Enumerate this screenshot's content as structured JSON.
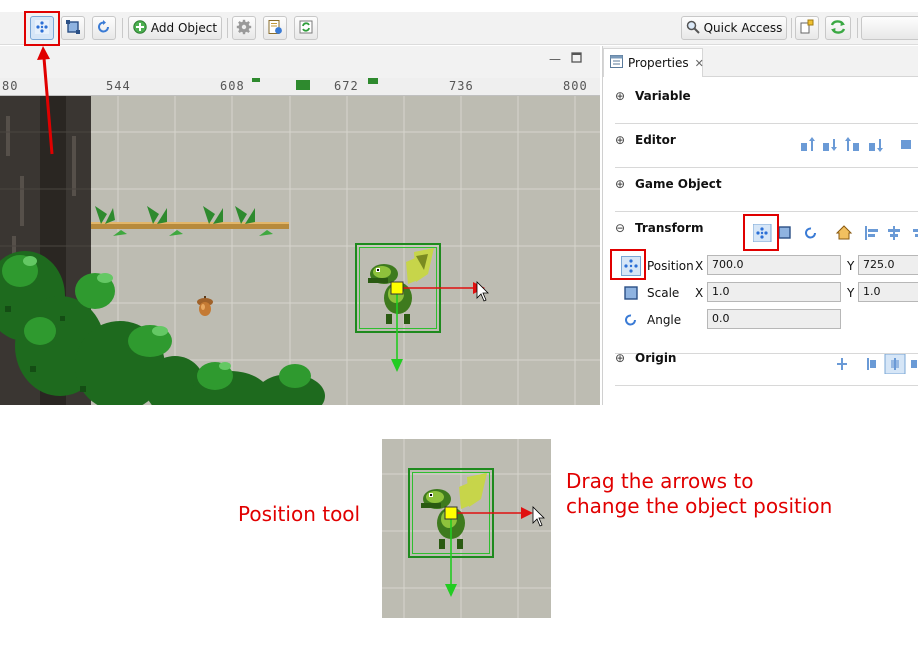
{
  "toolbar": {
    "add_object_label": "Add Object",
    "quick_access_label": "Quick Access",
    "tools": [
      {
        "icon": "position-tool-icon",
        "active": true
      },
      {
        "icon": "scale-tool-icon",
        "active": false
      },
      {
        "icon": "angle-tool-icon",
        "active": false
      }
    ]
  },
  "scene": {
    "ruler_labels": [
      "80",
      "544",
      "608",
      "672",
      "736",
      "800"
    ]
  },
  "properties": {
    "tab_label": "Properties",
    "sections": {
      "variable": "Variable",
      "editor": "Editor",
      "game_object": "Game Object",
      "transform": "Transform",
      "origin": "Origin"
    },
    "transform": {
      "position_label": "Position",
      "scale_label": "Scale",
      "angle_label": "Angle",
      "x_axis": "X",
      "y_axis": "Y",
      "position_x": "700.0",
      "position_y": "725.0",
      "scale_x": "1.0",
      "scale_y": "1.0",
      "angle": "0.0"
    }
  },
  "captions": {
    "position_tool": "Position tool",
    "drag_line1": "Drag the arrows to",
    "drag_line2": "change the object position"
  },
  "colors": {
    "highlight": "#e00000",
    "x_handle": "#e01010",
    "y_handle": "#22cc22",
    "selection": "#1e8a1e"
  }
}
